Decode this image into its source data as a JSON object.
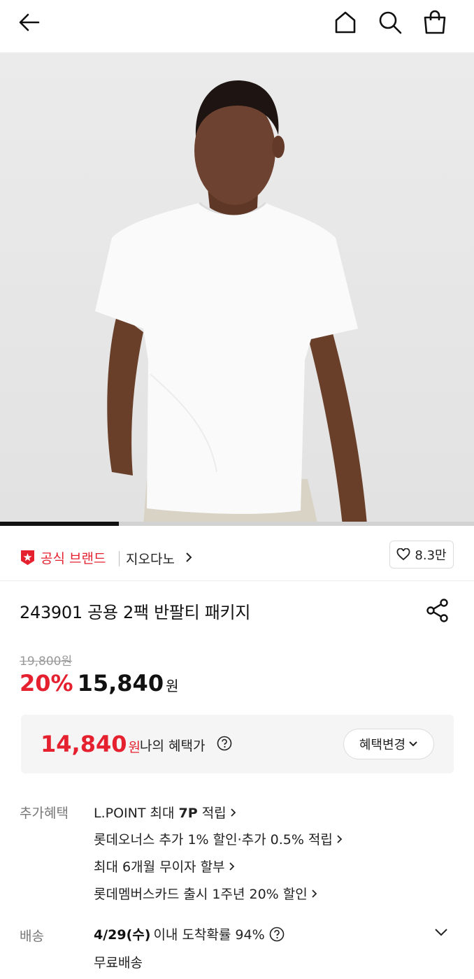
{
  "header": {
    "icons": [
      "back-arrow-icon",
      "home-icon",
      "search-icon",
      "shopping-bag-icon"
    ]
  },
  "gallery": {
    "progress_fraction": 0.25
  },
  "brand": {
    "official_label": "공식 브랜드",
    "name": "지오다노",
    "likes": "8.3만",
    "accent_color": "#e5202f"
  },
  "product": {
    "title": "243901 공용 2팩 반팔티 패키지",
    "original_price": "19,800원",
    "discount_rate": "20%",
    "sale_price": "15,840",
    "sale_currency": "원"
  },
  "benefit_price": {
    "amount": "14,840",
    "currency": "원",
    "label": "나의 혜택가",
    "change_button": "혜택변경"
  },
  "extra_benefits": {
    "label": "추가혜택",
    "items": [
      {
        "prefix": "L.POINT 최대 ",
        "bold": "7P",
        "suffix": " 적립"
      },
      {
        "text": "롯데오너스 추가 1% 할인·추가 0.5% 적립"
      },
      {
        "text": "최대 6개월 무이자 할부"
      },
      {
        "text": "롯데멤버스카드 출시 1주년 20% 할인"
      }
    ]
  },
  "shipping": {
    "label": "배송",
    "date": "4/29(수)",
    "probability": "이내 도착확률 94%",
    "fee": "무료배송"
  }
}
